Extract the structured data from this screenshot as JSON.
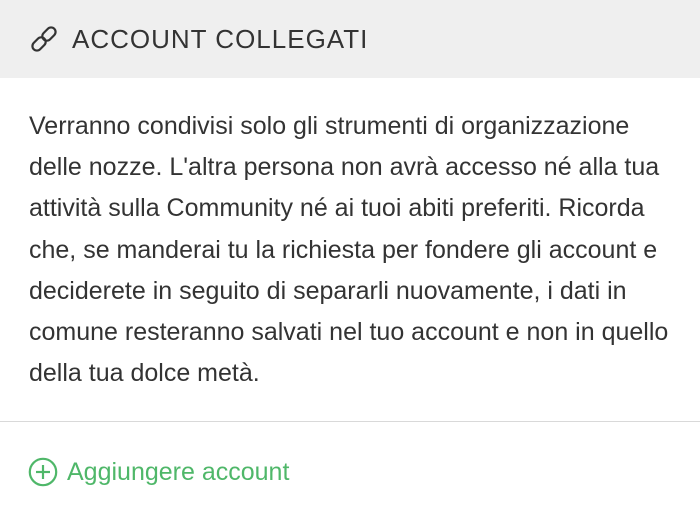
{
  "header": {
    "icon": "link-icon",
    "title": "ACCOUNT COLLEGATI"
  },
  "body": {
    "description": "Verranno condivisi solo gli strumenti di organizzazione delle nozze. L'altra persona non avrà accesso né alla tua attività sulla Community né ai tuoi abiti preferiti. Ricorda che, se manderai tu la richiesta per fondere gli account e deciderete in seguito di separarli nuovamente, i dati in comune resteranno salvati nel tuo account e non in quello della tua dolce metà."
  },
  "actions": {
    "add_icon": "plus-circle-icon",
    "add_label": "Aggiungere account"
  },
  "colors": {
    "header_bg": "#efefef",
    "text": "#333333",
    "accent": "#4fb769"
  }
}
